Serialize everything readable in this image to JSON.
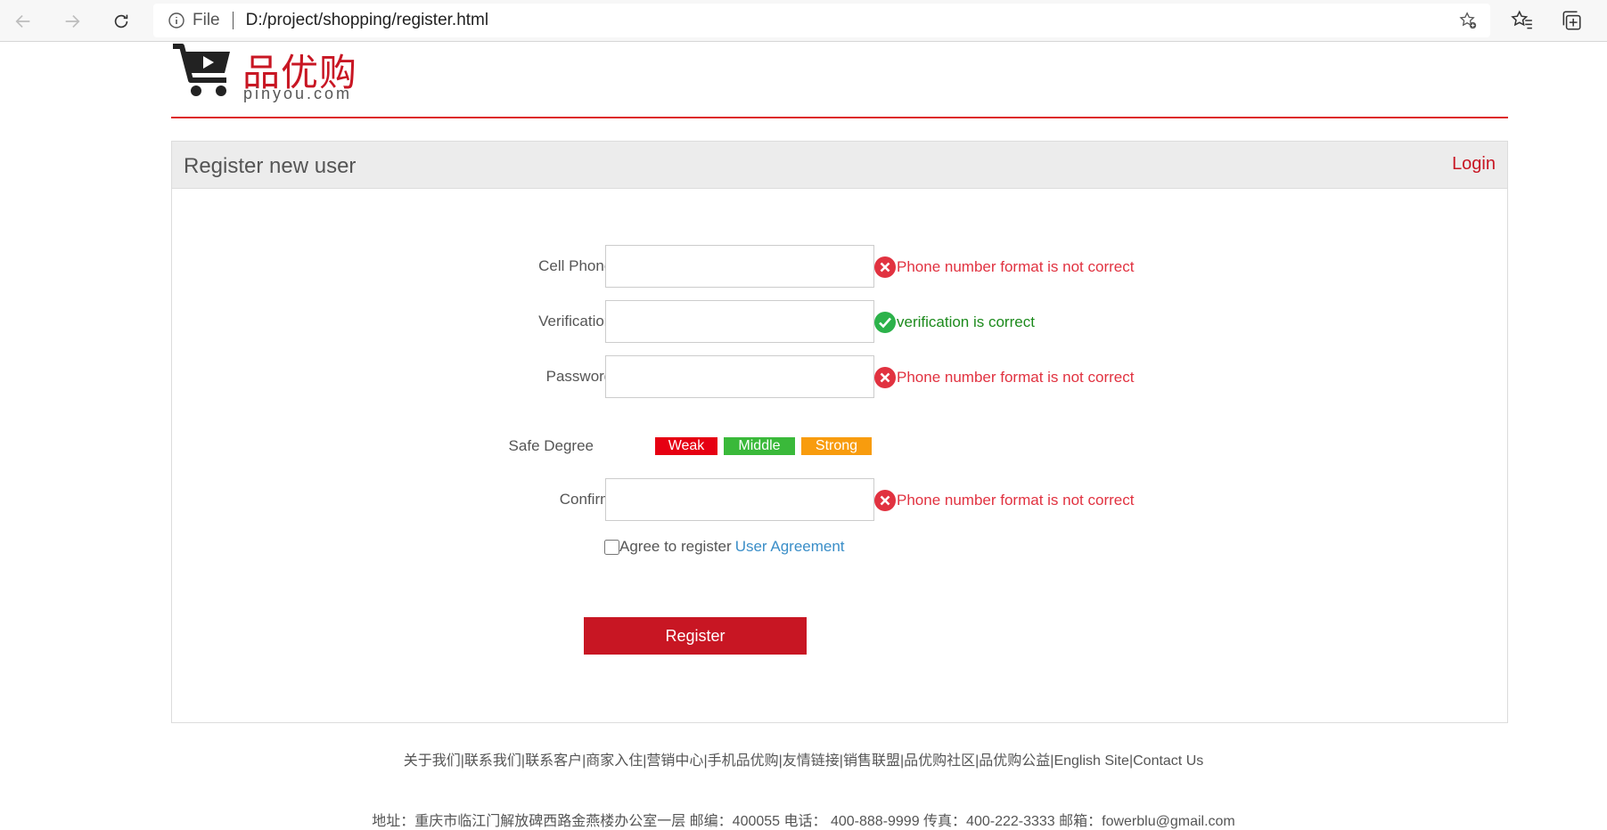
{
  "browser": {
    "scheme_label": "File",
    "url": "D:/project/shopping/register.html"
  },
  "logo": {
    "chinese": "品优购",
    "english": "pinyou.com"
  },
  "panel": {
    "title": "Register new user",
    "login_label": "Login"
  },
  "form": {
    "phone": {
      "label": "Cell Phone:",
      "value": "",
      "message": "Phone number format is not correct",
      "status": "error"
    },
    "verification": {
      "label": "Verification:",
      "value": "",
      "message": "verification is correct",
      "status": "ok"
    },
    "password": {
      "label": "Password:",
      "value": "",
      "message": "Phone number format is not correct",
      "status": "error"
    },
    "safe_degree": {
      "label": "Safe Degree",
      "levels": [
        {
          "label": "Weak",
          "color": "#e60012"
        },
        {
          "label": "Middle",
          "color": "#3ab93a"
        },
        {
          "label": "Strong",
          "color": "#f89c0e"
        }
      ]
    },
    "confirm": {
      "label": "Confirm:",
      "value": "",
      "message": "Phone number format is not correct",
      "status": "error"
    },
    "agree_text": "Agree to register",
    "agreement_link": "User Agreement",
    "agree_checked": false,
    "register_label": "Register"
  },
  "footer": {
    "links": [
      "关于我们",
      "联系我们",
      "联系客户",
      "商家入住",
      "营销中心",
      "手机品优购",
      "友情链接",
      "销售联盟",
      "品优购社区",
      "品优购公益",
      "English Site",
      "Contact Us"
    ],
    "address": "地址：重庆市临江门解放碑西路金燕楼办公室一层 邮编：400055 电话： 400-888-9999 传真：400-222-3333 邮箱：fowerblu@gmail.com"
  },
  "colors": {
    "brand": "#c81623",
    "error": "#e13240",
    "ok": "#1c8a1c",
    "link": "#3a8ec8"
  }
}
